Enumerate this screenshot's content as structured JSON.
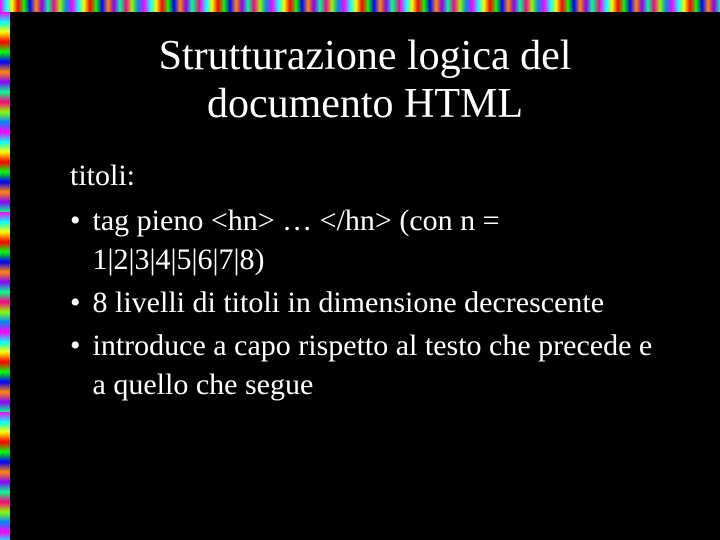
{
  "slide": {
    "title": "Strutturazione logica del documento HTML",
    "subtitle": "titoli:",
    "bullets": [
      "tag pieno <hn> … </hn> (con n = 1|2|3|4|5|6|7|8)",
      "8 livelli di titoli in dimensione decrescente",
      "introduce a capo rispetto al testo che precede e a quello che segue"
    ],
    "bullet_marker": "•"
  }
}
